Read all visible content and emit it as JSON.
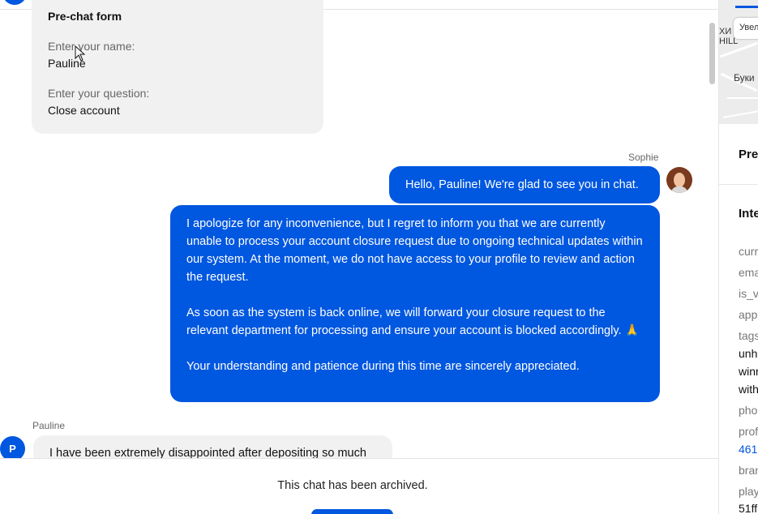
{
  "form": {
    "title": "Pre-chat form",
    "name_label": "Enter your name:",
    "name_value": "Pauline",
    "question_label": "Enter your question:",
    "question_value": "Close account"
  },
  "agent": {
    "name": "Sophie",
    "greeting": "Hello, Pauline! We're glad to see you in chat.",
    "message_p1": "I apologize for any inconvenience, but I regret to inform you that we are currently unable to process your account closure request due to ongoing technical updates within our system. At the moment, we do not have access to your profile to review and action the request.",
    "message_p2": "As soon as the system is back online, we will forward your closure request to the relevant department for processing and ensure your account is blocked accordingly. 🙏",
    "message_p3": "Your understanding and patience during this time are sincerely appreciated."
  },
  "user": {
    "name": "Pauline",
    "initial": "P",
    "message": "I have been extremely disappointed after depositing so much"
  },
  "footer": {
    "archived_text": "This chat has been archived."
  },
  "right_panel": {
    "map": {
      "zoom_label": "Увел",
      "district_label": "ХИ\nHILL",
      "place_label": "Буки"
    },
    "section_title_1": "Pre",
    "section_title_2": "Inte",
    "fields": [
      {
        "key": "curr"
      },
      {
        "key": "ema"
      },
      {
        "key": "is_v"
      },
      {
        "key": "app"
      },
      {
        "key": "tags",
        "values": [
          "unh",
          "winr",
          "with"
        ]
      },
      {
        "key": "pho"
      },
      {
        "key": "prof",
        "link": "461"
      },
      {
        "key": "bran"
      },
      {
        "key": "play",
        "values": [
          "51ff"
        ]
      }
    ]
  },
  "colors": {
    "accent": "#0057e0",
    "bubble_user": "#f1f1f1"
  }
}
